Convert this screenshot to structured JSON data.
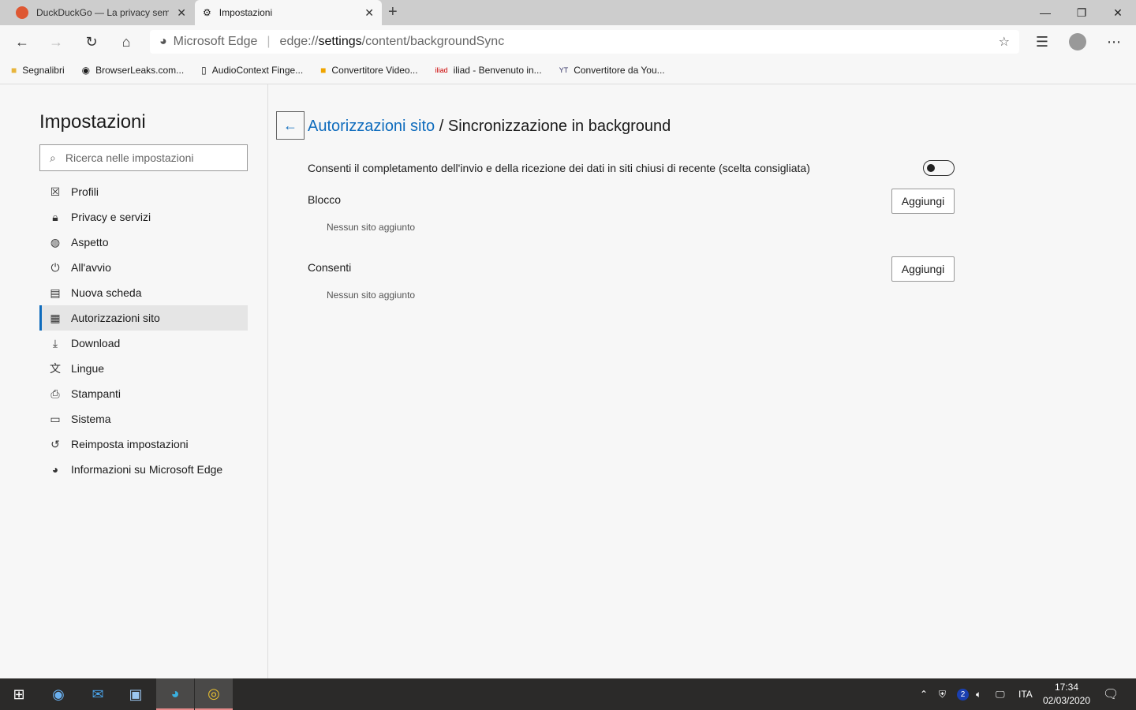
{
  "tabs": [
    {
      "title": "DuckDuckGo — La privacy semp",
      "icon": "duckduckgo-icon"
    },
    {
      "title": "Impostazioni",
      "icon": "gear-icon"
    }
  ],
  "address": {
    "site": "Microsoft Edge",
    "url_prefix": "edge://",
    "url_host": "settings",
    "url_path": "/content/backgroundSync"
  },
  "bookmarks": [
    "Segnalibri",
    "BrowserLeaks.com...",
    "AudioContext Finge...",
    "Convertitore Video...",
    "iliad - Benvenuto in...",
    "Convertitore da You..."
  ],
  "sidebar": {
    "title": "Impostazioni",
    "search_placeholder": "Ricerca nelle impostazioni",
    "items": [
      {
        "label": "Profili",
        "icon": "☒"
      },
      {
        "label": "Privacy e servizi",
        "icon": "🔒︎"
      },
      {
        "label": "Aspetto",
        "icon": "◍"
      },
      {
        "label": "All'avvio",
        "icon": "⏻"
      },
      {
        "label": "Nuova scheda",
        "icon": "▤"
      },
      {
        "label": "Autorizzazioni sito",
        "icon": "▦"
      },
      {
        "label": "Download",
        "icon": "⤓"
      },
      {
        "label": "Lingue",
        "icon": "文"
      },
      {
        "label": "Stampanti",
        "icon": "⎙"
      },
      {
        "label": "Sistema",
        "icon": "▭"
      },
      {
        "label": "Reimposta impostazioni",
        "icon": "↺"
      },
      {
        "label": "Informazioni su Microsoft Edge",
        "icon": "◕"
      }
    ]
  },
  "main": {
    "crumb_link": "Autorizzazioni sito",
    "crumb_sep": " / ",
    "crumb_current": "Sincronizzazione in background",
    "toggle_label": "Consenti il completamento dell'invio e della ricezione dei dati in siti chiusi di recente (scelta consigliata)",
    "toggle_on": false,
    "block_title": "Blocco",
    "allow_title": "Consenti",
    "add_label": "Aggiungi",
    "empty": "Nessun sito aggiunto"
  },
  "taskbar": {
    "lang": "ITA",
    "time": "17:34",
    "date": "02/03/2020",
    "badge": "2"
  }
}
